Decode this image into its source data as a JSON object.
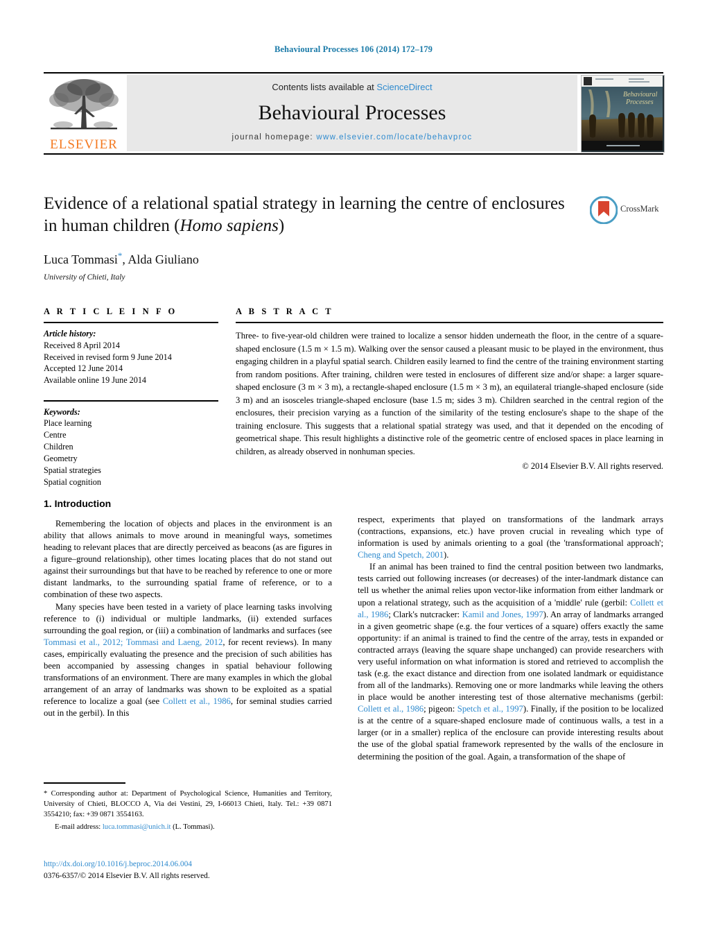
{
  "running_head": "Behavioural Processes 106 (2014) 172–179",
  "masthead": {
    "contents_prefix": "Contents lists available at ",
    "sciencedirect": "ScienceDirect",
    "journal_name": "Behavioural Processes",
    "homepage_prefix": "journal homepage: ",
    "homepage_url": "www.elsevier.com/locate/behavproc",
    "publisher_wordmark": "ELSEVIER",
    "cover_title_line1": "Behavioural",
    "cover_title_line2": "Processes",
    "accent_color": "#2E8ACE",
    "elsevier_orange": "#F47920"
  },
  "article": {
    "title_part1": "Evidence of a relational spatial strategy in learning the centre of enclosures in human children (",
    "title_italic": "Homo sapiens",
    "title_part2": ")",
    "authors": "Luca Tommasi",
    "corresponding_marker": "*",
    "authors_rest": ", Alda Giuliano",
    "affiliation": "University of Chieti, Italy",
    "crossmark_label": "CrossMark"
  },
  "info": {
    "heading": "A R T I C L E   I N F O",
    "history_label": "Article history:",
    "history": [
      "Received 8 April 2014",
      "Received in revised form 9 June 2014",
      "Accepted 12 June 2014",
      "Available online 19 June 2014"
    ],
    "keywords_label": "Keywords:",
    "keywords": [
      "Place learning",
      "Centre",
      "Children",
      "Geometry",
      "Spatial strategies",
      "Spatial cognition"
    ]
  },
  "abstract": {
    "heading": "A B S T R A C T",
    "text": "Three- to five-year-old children were trained to localize a sensor hidden underneath the floor, in the centre of a square-shaped enclosure (1.5 m × 1.5 m). Walking over the sensor caused a pleasant music to be played in the environment, thus engaging children in a playful spatial search. Children easily learned to find the centre of the training environment starting from random positions. After training, children were tested in enclosures of different size and/or shape: a larger square-shaped enclosure (3 m × 3 m), a rectangle-shaped enclosure (1.5 m × 3 m), an equilateral triangle-shaped enclosure (side 3 m) and an isosceles triangle-shaped enclosure (base 1.5 m; sides 3 m). Children searched in the central region of the enclosures, their precision varying as a function of the similarity of the testing enclosure's shape to the shape of the training enclosure. This suggests that a relational spatial strategy was used, and that it depended on the encoding of geometrical shape. This result highlights a distinctive role of the geometric centre of enclosed spaces in place learning in children, as already observed in nonhuman species.",
    "copyright": "© 2014 Elsevier B.V. All rights reserved."
  },
  "body": {
    "section_number_title": "1.  Introduction",
    "left_par1": "Remembering the location of objects and places in the environment is an ability that allows animals to move around in meaningful ways, sometimes heading to relevant places that are directly perceived as beacons (as are figures in a figure–ground relationship), other times locating places that do not stand out against their surroundings but that have to be reached by reference to one or more distant landmarks, to the surrounding spatial frame of reference, or to a combination of these two aspects.",
    "left_par2_a": "Many species have been tested in a variety of place learning tasks involving reference to (i) individual or multiple landmarks, (ii) extended surfaces surrounding the goal region, or (iii) a combination of landmarks and surfaces (see ",
    "left_par2_ref1": "Tommasi et al., 2012; Tommasi and Laeng, 2012",
    "left_par2_b": ", for recent reviews). In many cases, empirically evaluating the presence and the precision of such abilities has been accompanied by assessing changes in spatial behaviour following transformations of an environment. There are many examples in which the global arrangement of an array of landmarks was shown to be exploited as a spatial reference to localize a goal (see ",
    "left_par2_ref2": "Collett et al., 1986",
    "left_par2_c": ", for seminal studies carried out in the gerbil). In this",
    "right_par1_a": "respect, experiments that played on transformations of the landmark arrays (contractions, expansions, etc.) have proven crucial in revealing which type of information is used by animals orienting to a goal (the 'transformational approach'; ",
    "right_par1_ref": "Cheng and Spetch, 2001",
    "right_par1_b": ").",
    "right_par2_a": "If an animal has been trained to find the central position between two landmarks, tests carried out following increases (or decreases) of the inter-landmark distance can tell us whether the animal relies upon vector-like information from either landmark or upon a relational strategy, such as the acquisition of a 'middle' rule (gerbil: ",
    "right_par2_ref1": "Collett et al., 1986",
    "right_par2_b": "; Clark's nutcracker: ",
    "right_par2_ref2": "Kamil and Jones, 1997",
    "right_par2_c": "). An array of landmarks arranged in a given geometric shape (e.g. the four vertices of a square) offers exactly the same opportunity: if an animal is trained to find the centre of the array, tests in expanded or contracted arrays (leaving the square shape unchanged) can provide researchers with very useful information on what information is stored and retrieved to accomplish the task (e.g. the exact distance and direction from one isolated landmark or equidistance from all of the landmarks). Removing one or more landmarks while leaving the others in place would be another interesting test of those alternative mechanisms (gerbil: ",
    "right_par2_ref3": "Collett et al., 1986",
    "right_par2_d": "; pigeon: ",
    "right_par2_ref4": "Spetch et al., 1997",
    "right_par2_e": "). Finally, if the position to be localized is at the centre of a square-shaped enclosure made of continuous walls, a test in a larger (or in a smaller) replica of the enclosure can provide interesting results about the use of the global spatial framework represented by the walls of the enclosure in determining the position of the goal. Again, a transformation of the shape of"
  },
  "footnote": {
    "marker": "*",
    "text": " Corresponding author at: Department of Psychological Science, Humanities and Territory, University of Chieti, BLOCCO A, Via dei Vestini, 29, I-66013 Chieti, Italy. Tel.: +39 0871 3554210; fax: +39 0871 3554163.",
    "email_label": "E-mail address:",
    "email": "luca.tommasi@unich.it",
    "email_attrib": " (L. Tommasi)."
  },
  "imprint": {
    "doi": "http://dx.doi.org/10.1016/j.beproc.2014.06.004",
    "issn_line": "0376-6357/© 2014 Elsevier B.V. All rights reserved."
  }
}
